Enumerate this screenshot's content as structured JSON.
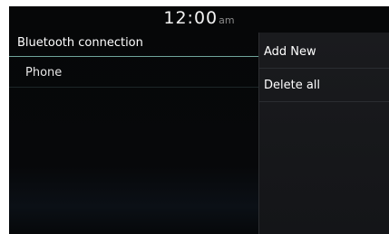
{
  "status_bar": {
    "time": "12:00",
    "ampm": "am"
  },
  "list": {
    "title": "Bluetooth connection",
    "items": [
      {
        "label": "Phone"
      }
    ]
  },
  "menu": {
    "items": [
      {
        "label": "Add New"
      },
      {
        "label": "Delete all"
      }
    ]
  }
}
